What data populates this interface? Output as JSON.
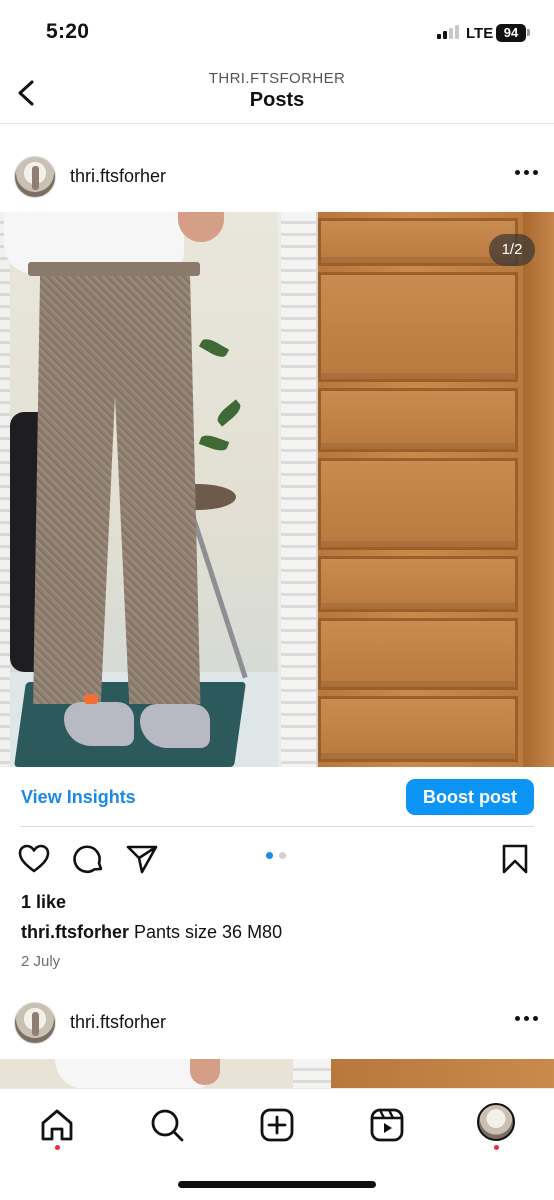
{
  "status_bar": {
    "time": "5:20",
    "network": "LTE",
    "battery": "94"
  },
  "header": {
    "subtitle": "THRI.FTSFORHER",
    "title": "Posts"
  },
  "post": {
    "username": "thri.ftsforher",
    "image_counter": "1/2",
    "view_insights_label": "View Insights",
    "boost_label": "Boost post",
    "likes": "1 like",
    "caption_user": "thri.ftsforher",
    "caption_text": " Pants size 36 M80",
    "date": "2 July",
    "carousel": {
      "total": 2,
      "active": 1
    }
  },
  "next_post": {
    "username": "thri.ftsforher"
  },
  "icons": {
    "back": "chevron-left-icon",
    "more": "more-horizontal-icon",
    "like": "heart-icon",
    "comment": "comment-icon",
    "share": "send-icon",
    "save": "bookmark-icon",
    "home": "home-icon",
    "search": "search-icon",
    "create": "plus-square-icon",
    "reels": "reels-icon"
  },
  "colors": {
    "accent": "#0d95f6",
    "link": "#1a8ae6",
    "notification": "#ee2b3d"
  }
}
